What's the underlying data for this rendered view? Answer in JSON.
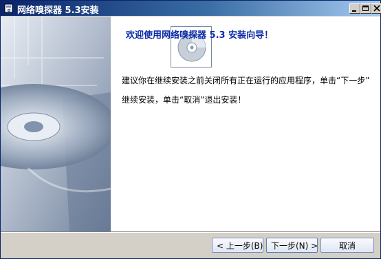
{
  "window": {
    "title": "网络嗅探器 5.3安装"
  },
  "wizard": {
    "heading": "欢迎使用网络嗅探器 5.3 安装向导！",
    "body_line1": "建议你在继续安装之前关闭所有正在运行的应用程序，单击“下一步”",
    "body_line2": "继续安装，单击“取消”退出安装！"
  },
  "buttons": {
    "back": "< 上一步(B)",
    "next": "下一步(N) >",
    "cancel": "取消"
  },
  "icons": {
    "installer": "installer-icon",
    "disc": "cd-disc-icon",
    "minimize": "minimize-icon",
    "maximize": "maximize-icon",
    "close": "close-icon"
  }
}
